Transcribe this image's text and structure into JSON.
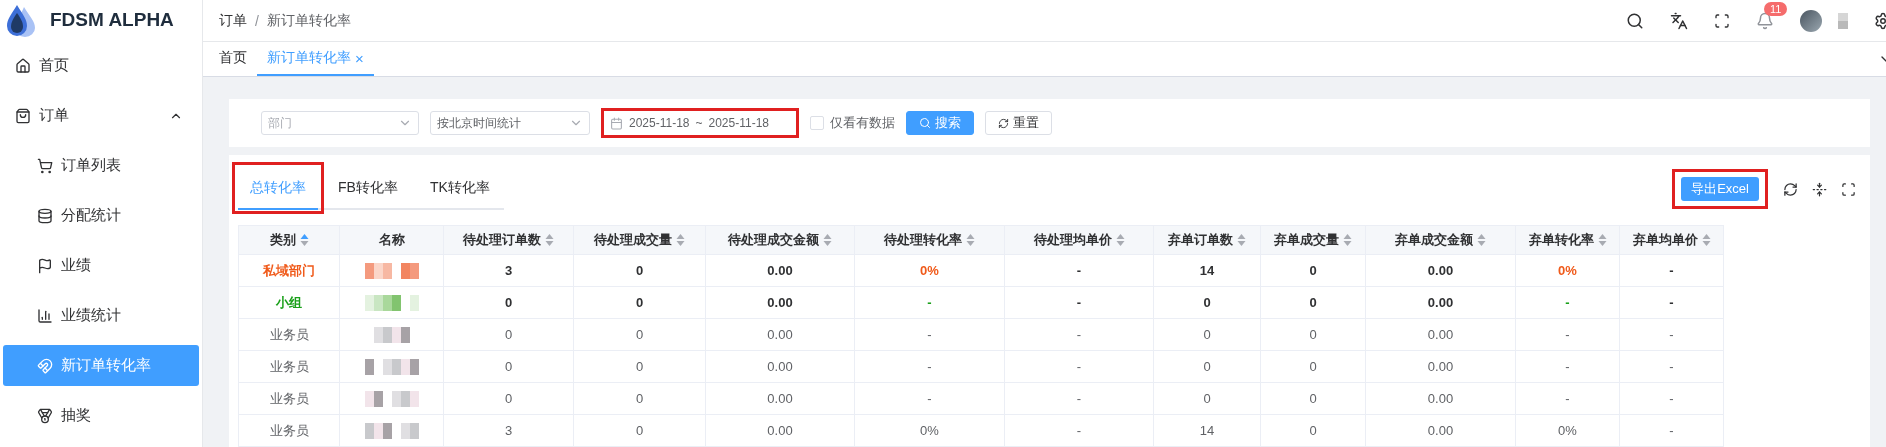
{
  "sidebar": {
    "brand": "FDSM ALPHA",
    "items": [
      {
        "label": "首页",
        "selected": false
      },
      {
        "label": "订单",
        "selected": false,
        "expanded": true,
        "children": [
          {
            "label": "订单列表",
            "selected": false
          },
          {
            "label": "分配统计",
            "selected": false
          },
          {
            "label": "业绩",
            "selected": false
          },
          {
            "label": "业绩统计",
            "selected": false
          },
          {
            "label": "新订单转化率",
            "selected": true
          },
          {
            "label": "抽奖",
            "selected": false
          }
        ]
      }
    ]
  },
  "header": {
    "breadcrumb": [
      "订单",
      "新订单转化率"
    ],
    "separator": "/",
    "notification_count": "11"
  },
  "page_tabs": [
    {
      "label": "首页",
      "selected": false
    },
    {
      "label": "新订单转化率",
      "selected": true,
      "close": "×"
    }
  ],
  "filters": {
    "department": {
      "placeholder": "部门"
    },
    "time_basis": {
      "value": "按北京时间统计"
    },
    "date_range": {
      "start": "2025-11-18",
      "separator": "~",
      "end": "2025-11-18",
      "highlighted": true
    },
    "only_with_data": {
      "label": "仅看有数据",
      "checked": false
    },
    "search_button": "搜索",
    "reset_button": "重置"
  },
  "report_tabs": [
    {
      "label": "总转化率",
      "selected": true,
      "highlighted": true
    },
    {
      "label": "FB转化率",
      "selected": false,
      "highlighted": false
    },
    {
      "label": "TK转化率",
      "selected": false,
      "highlighted": false
    }
  ],
  "export_button": {
    "label": "导出Excel",
    "highlighted": true
  },
  "table": {
    "columns": [
      {
        "label": "类别",
        "sortable": true,
        "sorted": true
      },
      {
        "label": "名称",
        "sortable": false
      },
      {
        "label": "待处理订单数",
        "sortable": true,
        "sorted": false
      },
      {
        "label": "待处理成交量",
        "sortable": true,
        "sorted": false
      },
      {
        "label": "待处理成交金额",
        "sortable": true,
        "sorted": false
      },
      {
        "label": "待处理转化率",
        "sortable": true,
        "sorted": false
      },
      {
        "label": "待处理均单价",
        "sortable": true,
        "sorted": false
      },
      {
        "label": "弃单订单数",
        "sortable": true,
        "sorted": false
      },
      {
        "label": "弃单成交量",
        "sortable": true,
        "sorted": false
      },
      {
        "label": "弃单成交金额",
        "sortable": true,
        "sorted": false
      },
      {
        "label": "弃单转化率",
        "sortable": true,
        "sorted": false
      },
      {
        "label": "弃单均单价",
        "sortable": true,
        "sorted": false
      }
    ],
    "rows": [
      {
        "kind": "department",
        "cells": [
          "私域部门",
          "",
          "3",
          "0",
          "0.00",
          "0%",
          "-",
          "14",
          "0",
          "0.00",
          "0%",
          "-"
        ]
      },
      {
        "kind": "group",
        "cells": [
          "小组",
          "",
          "0",
          "0",
          "0.00",
          "-",
          "-",
          "0",
          "0",
          "0.00",
          "-",
          "-"
        ]
      },
      {
        "kind": "staff",
        "cells": [
          "业务员",
          "",
          "0",
          "0",
          "0.00",
          "-",
          "-",
          "0",
          "0",
          "0.00",
          "-",
          "-"
        ]
      },
      {
        "kind": "staff",
        "cells": [
          "业务员",
          "",
          "0",
          "0",
          "0.00",
          "-",
          "-",
          "0",
          "0",
          "0.00",
          "-",
          "-"
        ]
      },
      {
        "kind": "staff",
        "cells": [
          "业务员",
          "",
          "0",
          "0",
          "0.00",
          "-",
          "-",
          "0",
          "0",
          "0.00",
          "-",
          "-"
        ]
      },
      {
        "kind": "staff",
        "cells": [
          "业务员",
          "",
          "3",
          "0",
          "0.00",
          "0%",
          "-",
          "14",
          "0",
          "0.00",
          "0%",
          "-"
        ]
      }
    ]
  }
}
